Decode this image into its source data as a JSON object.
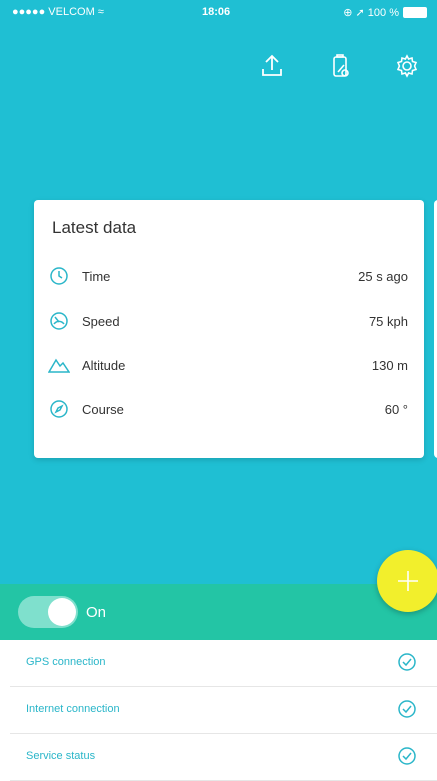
{
  "status_bar": {
    "carrier": "●●●●● VELCOM ≈",
    "time": "18:06",
    "battery": "⊕ ➚ 100 %"
  },
  "toolbar": {
    "icons": [
      "upload-icon",
      "device-status-icon",
      "gear-icon"
    ]
  },
  "card": {
    "title": "Latest data",
    "rows": [
      {
        "label": "Time",
        "value": "25 s ago",
        "icon": "clock-icon"
      },
      {
        "label": "Speed",
        "value": "75 kph",
        "icon": "speedometer-icon"
      },
      {
        "label": "Altitude",
        "value": "130 m",
        "icon": "mountain-icon"
      },
      {
        "label": "Course",
        "value": "60 °",
        "icon": "compass-icon"
      }
    ]
  },
  "fab": {
    "icon": "plus-icon"
  },
  "toggle": {
    "label": "On",
    "state": "on"
  },
  "status_list": [
    {
      "label": "GPS connection"
    },
    {
      "label": "Internet connection"
    },
    {
      "label": "Service status"
    }
  ],
  "colors": {
    "primary": "#1fbfd3",
    "toggle_bar": "#23c5a5",
    "fab": "#f2ef2c",
    "link": "#2ab6c9"
  }
}
